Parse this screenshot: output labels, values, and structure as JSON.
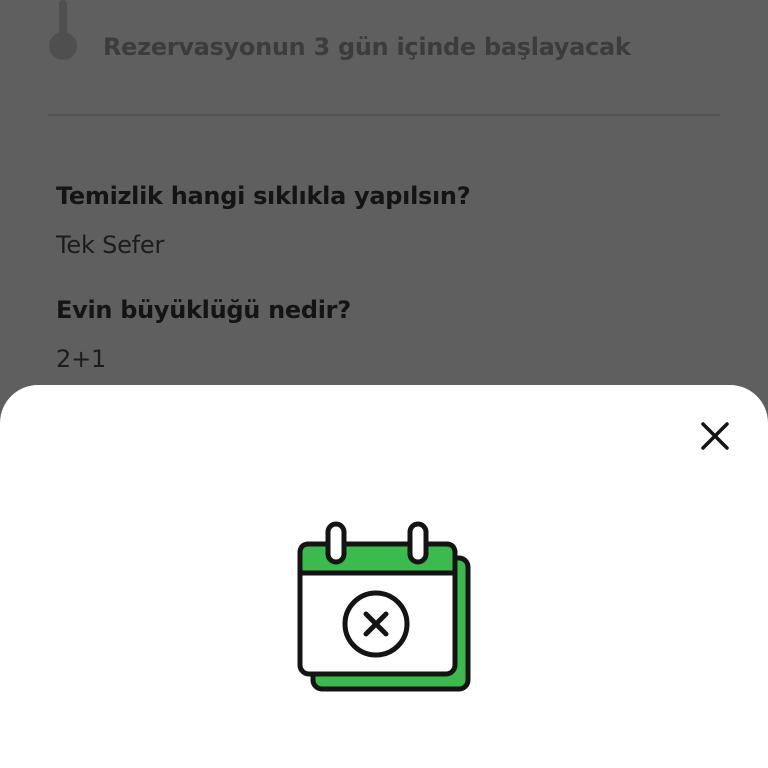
{
  "timeline": {
    "item_text": "Rezervasyonun 3 gün içinde başlayacak"
  },
  "details": [
    {
      "question": "Temizlik hangi sıklıkla yapılsın?",
      "answer": "Tek Sefer"
    },
    {
      "question": "Evin büyüklüğü nedir?",
      "answer": "2+1"
    }
  ],
  "modal": {
    "close_icon": "close-icon",
    "illustration_icon": "calendar-cancel-icon"
  },
  "colors": {
    "overlay_background": "#5f5f5f",
    "sheet_background": "#ffffff",
    "accent_green": "#3dba4e",
    "icon_stroke": "#141414"
  }
}
